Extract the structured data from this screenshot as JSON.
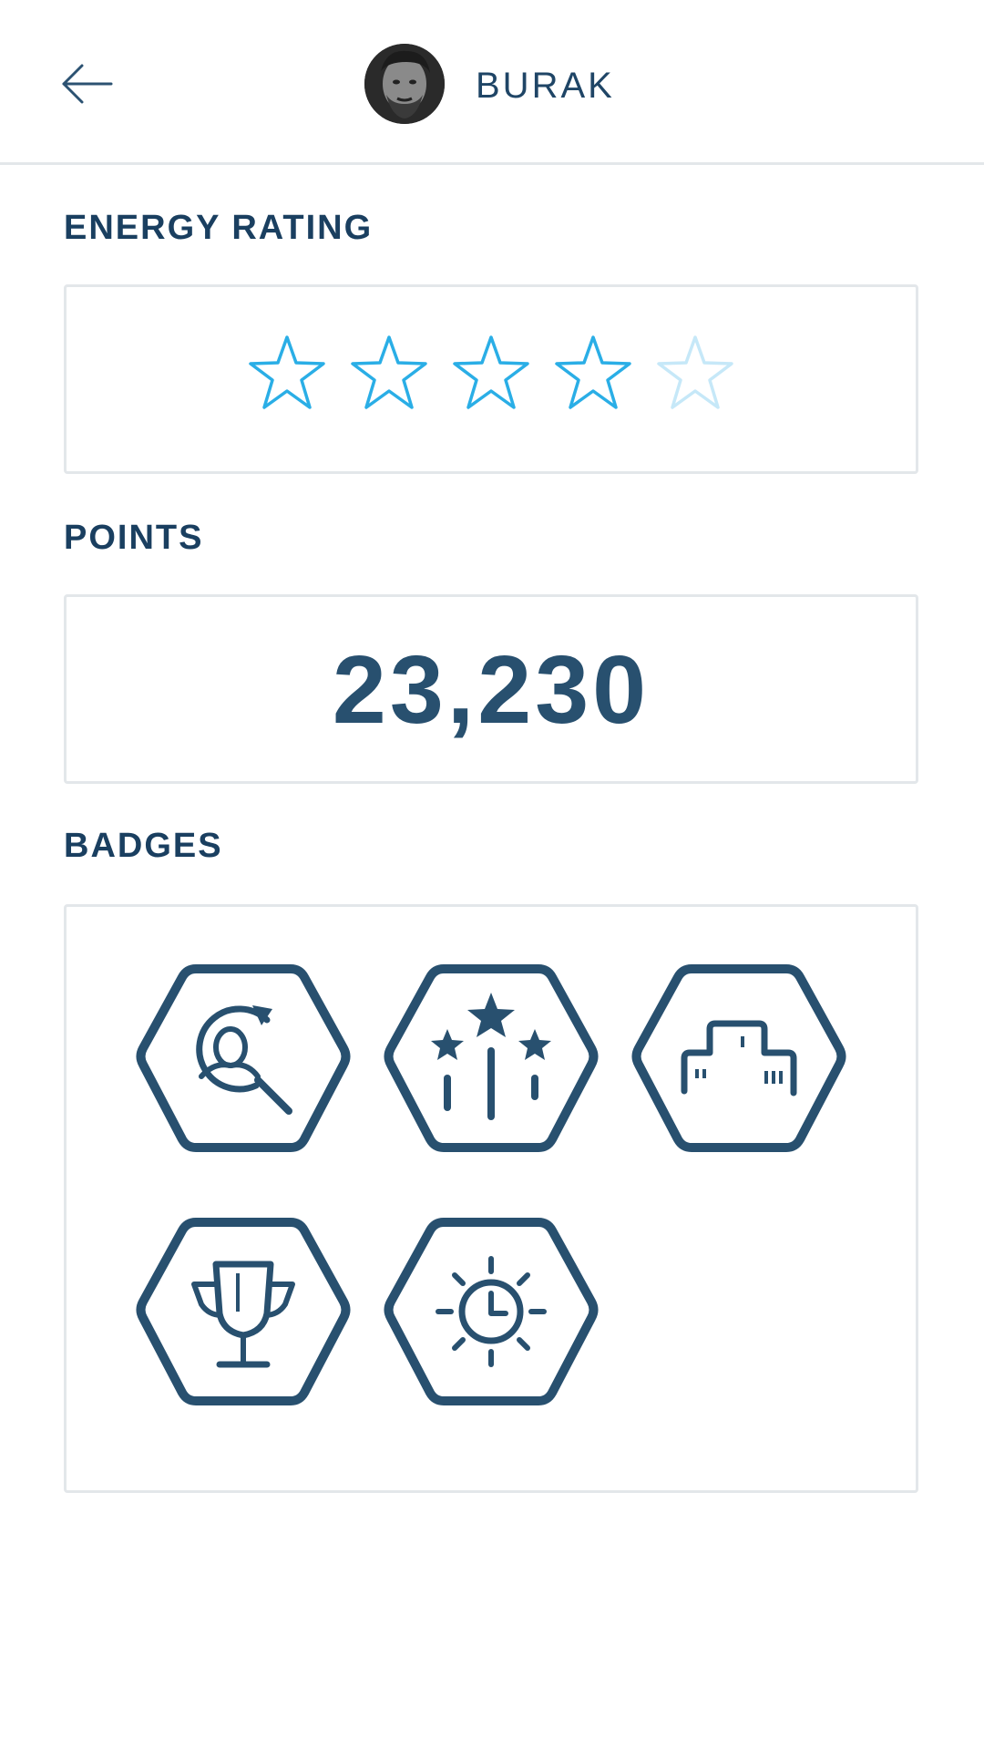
{
  "header": {
    "back_icon": "arrow-left-icon",
    "user_name": "BURAK",
    "avatar_icon": "user-avatar-photo"
  },
  "energy_rating": {
    "label": "ENERGY RATING",
    "rating": 4,
    "max": 5,
    "star_color": "#2aaee6",
    "star_inactive_color": "#c6e8f8"
  },
  "points": {
    "label": "POINTS",
    "value": "23,230"
  },
  "badges": {
    "label": "BADGES",
    "color": "#28506f",
    "items": [
      {
        "icon": "user-search-badge-icon"
      },
      {
        "icon": "stars-rising-badge-icon"
      },
      {
        "icon": "building-badge-icon"
      },
      {
        "icon": "trophy-badge-icon"
      },
      {
        "icon": "sun-clock-badge-icon"
      }
    ]
  }
}
